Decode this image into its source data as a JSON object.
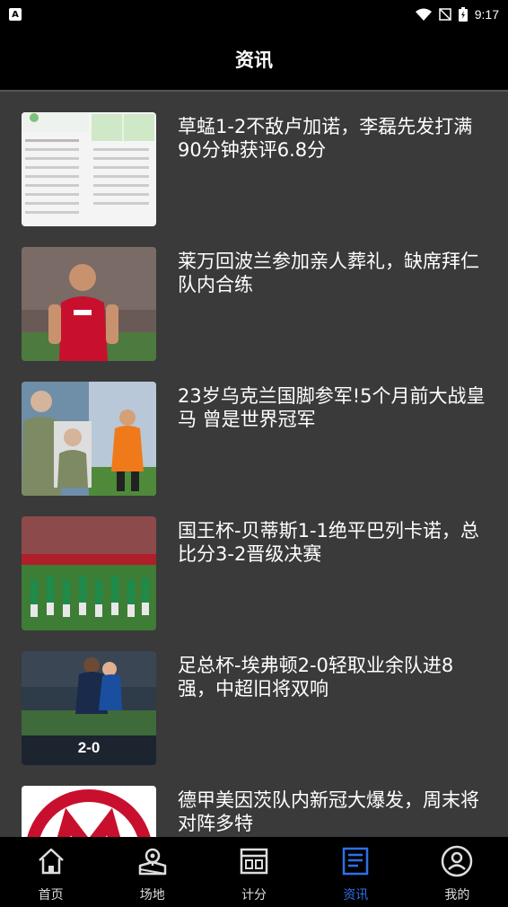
{
  "status_bar": {
    "time": "9:17",
    "app_badge": "A"
  },
  "header": {
    "title": "资讯"
  },
  "news": [
    {
      "title": "草蜢1-2不敌卢加诺，李磊先发打满90分钟获评6.8分",
      "thumb": "stats-table"
    },
    {
      "title": "莱万回波兰参加亲人葬礼，缺席拜仁队内合练",
      "thumb": "player-red-kit"
    },
    {
      "title": "23岁乌克兰国脚参军!5个月前大战皇马 曾是世界冠军",
      "thumb": "soldier-and-match"
    },
    {
      "title": "国王杯-贝蒂斯1-1绝平巴列卡诺，总比分3-2晋级决赛",
      "thumb": "team-on-pitch"
    },
    {
      "title": "足总杯-埃弗顿2-0轻取业余队进8强，中超旧将双响",
      "thumb": "match-score",
      "score_text": "2-0"
    },
    {
      "title": "德甲美因茨队内新冠大爆发，周末将对阵多特",
      "thumb": "mainz-logo"
    }
  ],
  "tabbar": {
    "items": [
      {
        "label": "首页",
        "icon": "home-icon"
      },
      {
        "label": "场地",
        "icon": "map-icon"
      },
      {
        "label": "计分",
        "icon": "scoreboard-icon"
      },
      {
        "label": "资讯",
        "icon": "news-icon"
      },
      {
        "label": "我的",
        "icon": "profile-icon"
      }
    ],
    "active_index": 3,
    "active_color": "#2f6fe8",
    "inactive_color": "#dddddd"
  }
}
